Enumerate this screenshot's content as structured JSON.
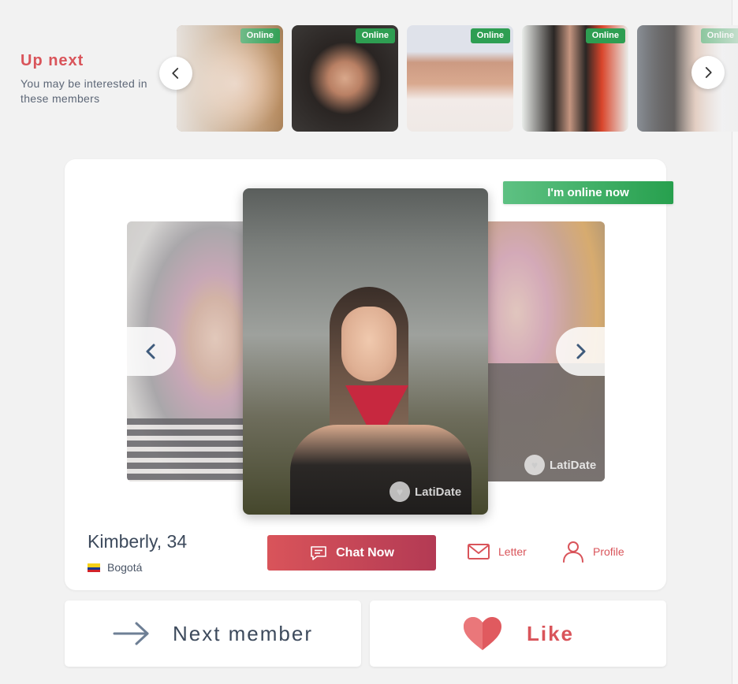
{
  "up_next": {
    "title": "Up next",
    "subtitle": "You may be interested in these members",
    "online_badge": "Online"
  },
  "member": {
    "status": "I'm online now",
    "name": "Kimberly, 34",
    "city": "Bogotá"
  },
  "actions": {
    "chat": "Chat Now",
    "letter": "Letter",
    "profile": "Profile",
    "next": "Next member",
    "like": "Like"
  },
  "watermark": "LatiDate",
  "colors": {
    "accent": "#d9545a",
    "online_green": "#2e9e52",
    "text_dark": "#3d4a5c"
  },
  "icons": [
    "chevron-left-icon",
    "chevron-right-icon",
    "chat-bubble-icon",
    "envelope-icon",
    "person-icon",
    "arrow-right-icon",
    "heart-icon"
  ]
}
